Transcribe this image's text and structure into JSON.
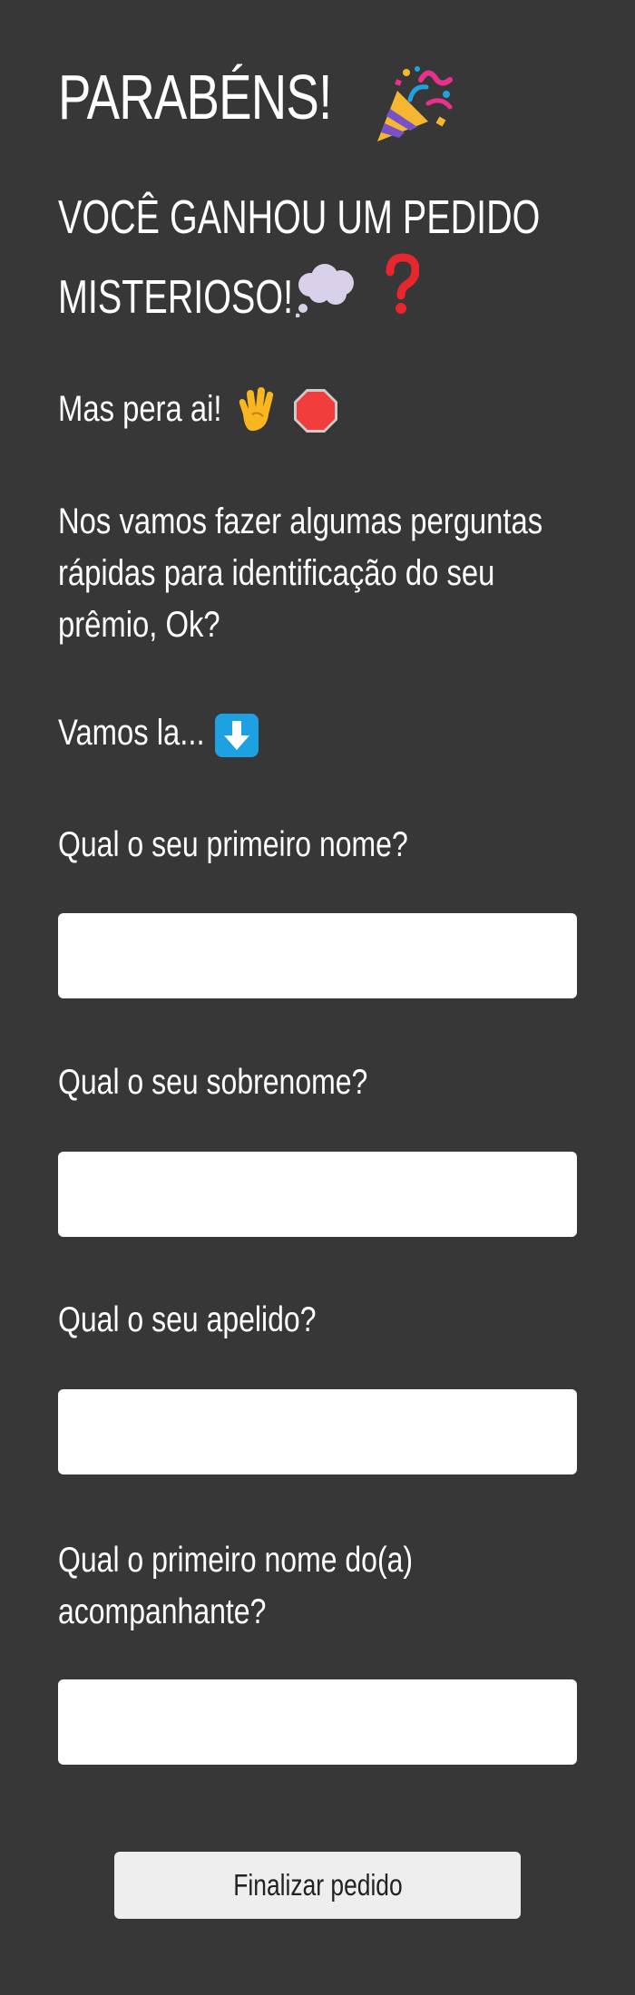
{
  "header": {
    "title": "PARABÉNS!",
    "title_icon": "party-popper-icon",
    "subtitle": "VOCÊ GANHOU UM PEDIDO MISTERIOSO!",
    "subtitle_icons": [
      "thought-balloon-icon",
      "question-mark-icon"
    ]
  },
  "intro": {
    "wait_text": "Mas pera ai!",
    "wait_icons": [
      "raised-hand-icon",
      "stop-sign-icon"
    ],
    "explanation": "Nos vamos fazer algumas perguntas rápidas para identificação do seu prêmio, Ok?",
    "lets_go": "Vamos la...",
    "lets_go_icon": "down-arrow-icon"
  },
  "form": {
    "first_name_label": "Qual o seu primeiro nome?",
    "first_name_value": "",
    "last_name_label": "Qual o seu sobrenome?",
    "last_name_value": "",
    "nickname_label": "Qual o seu apelido?",
    "nickname_value": "",
    "companion_label": "Qual o primeiro nome do(a) acompanhante?",
    "companion_value": "",
    "submit_label": "Finalizar pedido"
  },
  "colors": {
    "background": "#373737",
    "text": "#ffffff",
    "input_background": "#ffffff",
    "button_background": "#eeeeee",
    "stop_sign": "#f23d3d",
    "question_mark": "#e8262d",
    "arrow_box": "#1da1e2",
    "hand": "#f8b620"
  }
}
